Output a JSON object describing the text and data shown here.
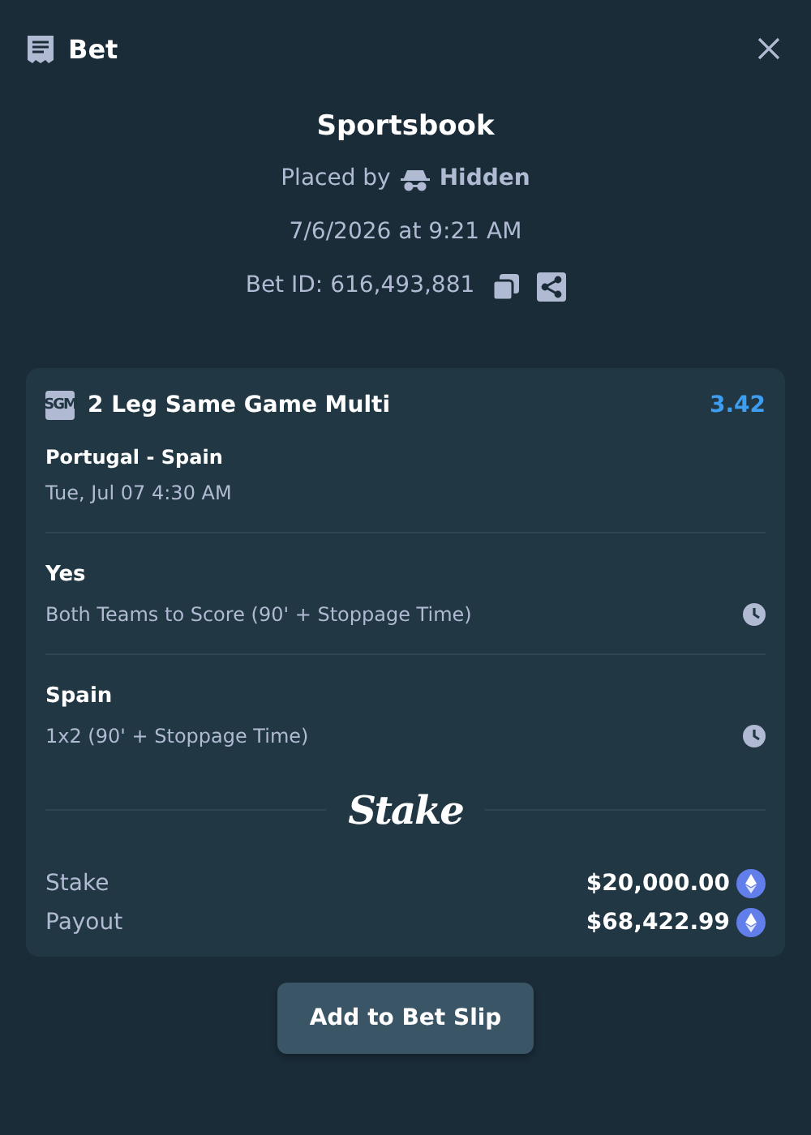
{
  "header": {
    "title": "Bet"
  },
  "summary": {
    "title": "Sportsbook",
    "placed_by_label": "Placed by",
    "placed_by_user": "Hidden",
    "date": "7/6/2026 at 9:21 AM",
    "bet_id": "Bet ID: 616,493,881"
  },
  "bet": {
    "badge": "SGM",
    "title": "2 Leg Same Game Multi",
    "odds": "3.42",
    "event": "Portugal - Spain",
    "event_time": "Tue, Jul 07 4:30 AM",
    "legs": [
      {
        "selection": "Yes",
        "market": "Both Teams to Score (90' + Stoppage Time)"
      },
      {
        "selection": "Spain",
        "market": "1x2 (90' + Stoppage Time)"
      }
    ],
    "brand": "Stake",
    "amounts": [
      {
        "label": "Stake",
        "value": "$20,000.00"
      },
      {
        "label": "Payout",
        "value": "$68,422.99"
      }
    ]
  },
  "button": "Add to Bet Slip"
}
